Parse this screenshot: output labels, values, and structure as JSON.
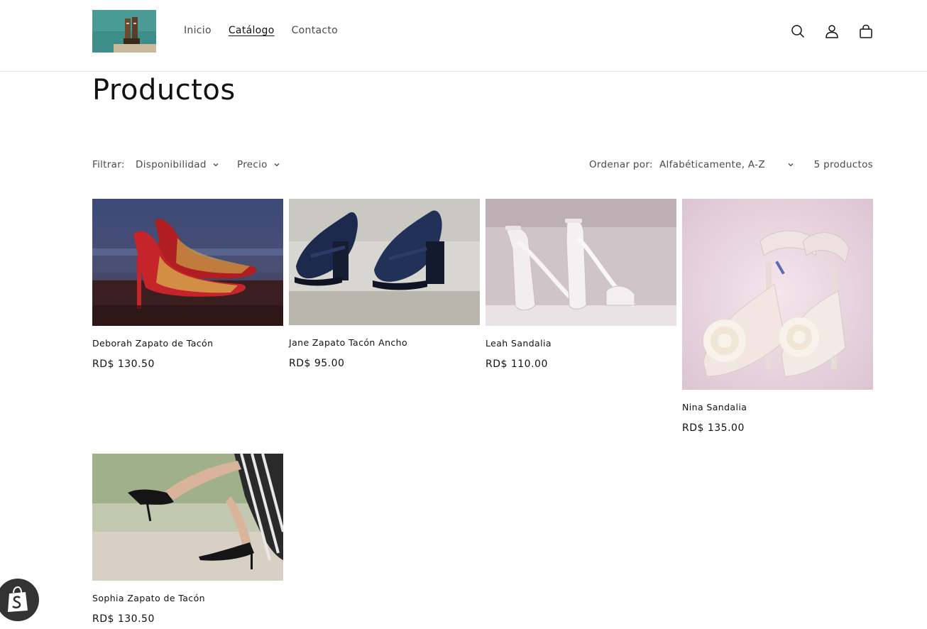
{
  "header": {
    "logo_alt": "logo",
    "nav": [
      {
        "label": "Inicio"
      },
      {
        "label": "Catálogo"
      },
      {
        "label": "Contacto"
      }
    ],
    "icons": [
      "search-icon",
      "account-icon",
      "cart-icon"
    ]
  },
  "main": {
    "title": "Productos"
  },
  "filters": {
    "label": "Filtrar:",
    "availability": "Disponibilidad",
    "price": "Precio",
    "sort_label": "Ordenar por:",
    "sort_value": "Alfabéticamente, A-Z",
    "count": "5 productos"
  },
  "products": [
    {
      "name": "Deborah Zapato de Tacón",
      "price": "RD$ 130.50"
    },
    {
      "name": "Jane Zapato Tacón Ancho",
      "price": "RD$ 95.00"
    },
    {
      "name": "Leah Sandalia",
      "price": "RD$ 110.00"
    },
    {
      "name": "Nina Sandalia",
      "price": "RD$ 135.00"
    },
    {
      "name": "Sophia Zapato de Tacón",
      "price": "RD$ 130.50"
    }
  ],
  "colors": {
    "text": "#121212",
    "muted": "#4a4a4a",
    "border": "#e6e6e6",
    "shopify_badge": "#333333"
  }
}
